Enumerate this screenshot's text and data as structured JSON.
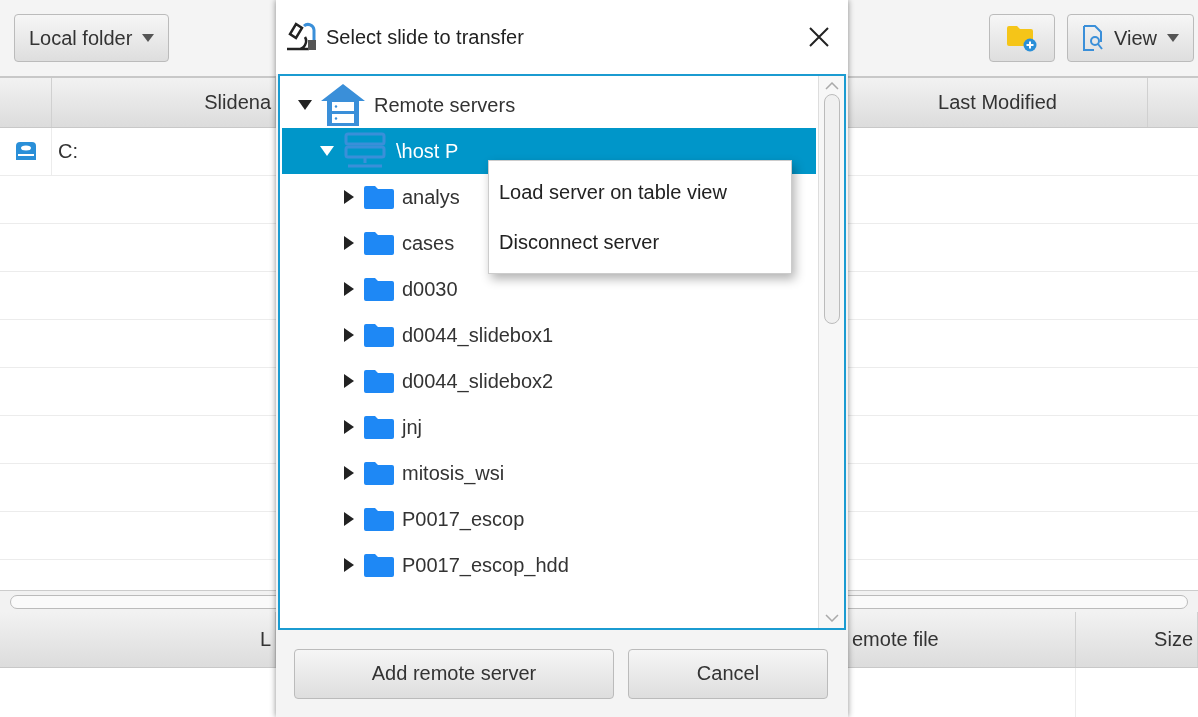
{
  "app": {
    "toolbar": {
      "source_dropdown": "Local folder",
      "view_dropdown": "View"
    },
    "table": {
      "columns": [
        "Slidena",
        "Last Modified"
      ],
      "rows": [
        {
          "name": "C:"
        }
      ]
    },
    "transfer_table": {
      "columns": [
        "L",
        "emote file",
        "Size"
      ]
    }
  },
  "dialog": {
    "title": "Select slide to transfer",
    "tree": [
      {
        "label": "Remote servers",
        "kind": "root",
        "expanded": true,
        "selected": false,
        "children": [
          {
            "label": "\\host P",
            "kind": "server",
            "expanded": true,
            "selected": true,
            "children": [
              {
                "label": "analys",
                "kind": "folder",
                "expanded": false,
                "selected": false
              },
              {
                "label": "cases",
                "kind": "folder",
                "expanded": false,
                "selected": false
              },
              {
                "label": "d0030",
                "kind": "folder",
                "expanded": false,
                "selected": false
              },
              {
                "label": "d0044_slidebox1",
                "kind": "folder",
                "expanded": false,
                "selected": false
              },
              {
                "label": "d0044_slidebox2",
                "kind": "folder",
                "expanded": false,
                "selected": false
              },
              {
                "label": "jnj",
                "kind": "folder",
                "expanded": false,
                "selected": false
              },
              {
                "label": "mitosis_wsi",
                "kind": "folder",
                "expanded": false,
                "selected": false
              },
              {
                "label": "P0017_escop",
                "kind": "folder",
                "expanded": false,
                "selected": false
              },
              {
                "label": "P0017_escop_hdd",
                "kind": "folder",
                "expanded": false,
                "selected": false
              }
            ]
          }
        ]
      }
    ],
    "context_menu": [
      "Load server on table view",
      "Disconnect server"
    ],
    "buttons": [
      "Add remote server",
      "Cancel"
    ]
  }
}
